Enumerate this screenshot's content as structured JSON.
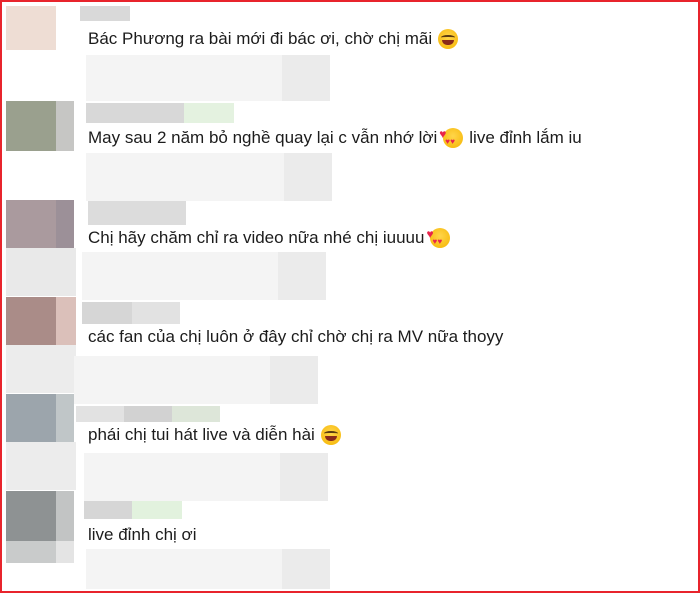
{
  "comments": [
    {
      "text": "Bác Phương ra bài mới đi bác ơi, chờ chị mãi",
      "emoji": "laughing-tears-icon"
    },
    {
      "text": "May sau 2 năm bỏ nghề quay lại c vẫn nhớ lời",
      "emoji": "smiling-hearts-icon",
      "text_after": "live đỉnh lắm iu"
    },
    {
      "text": "Chị hãy chăm chỉ ra video nữa nhé chị iuuuu",
      "emoji": "smiling-hearts-icon"
    },
    {
      "text": "các fan của chị luôn ở đây chỉ chờ chị ra MV nữa thoyy"
    },
    {
      "text": "phái chị tui hát live và diễn hài",
      "emoji": "laughing-tears-icon"
    },
    {
      "text": "live đỉnh chị ơi"
    }
  ],
  "colors": {
    "frame": "#e8242c",
    "text": "#1c1c1c",
    "blur_light": "#ececec",
    "blur_green": "#e4f2e0"
  }
}
